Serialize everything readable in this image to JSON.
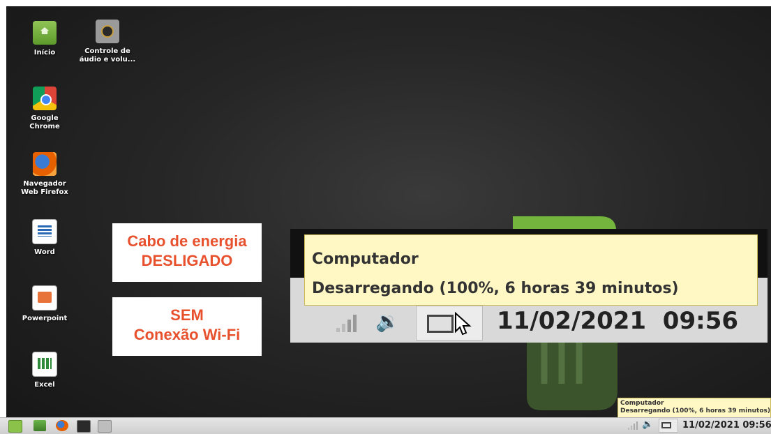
{
  "desktop": {
    "icons": [
      {
        "label_line1": "Início",
        "label_line2": "",
        "icon": "home-folder-icon"
      },
      {
        "label_line1": "Controle de",
        "label_line2": "áudio e volu...",
        "icon": "speaker-icon"
      },
      {
        "label_line1": "Google",
        "label_line2": "Chrome",
        "icon": "chrome-icon"
      },
      {
        "label_line1": "Navegador",
        "label_line2": "Web Firefox",
        "icon": "firefox-icon"
      },
      {
        "label_line1": "Word",
        "label_line2": "",
        "icon": "word-icon"
      },
      {
        "label_line1": "Powerpoint",
        "label_line2": "",
        "icon": "powerpoint-icon"
      },
      {
        "label_line1": "Excel",
        "label_line2": "",
        "icon": "excel-icon"
      }
    ]
  },
  "notes": {
    "power": {
      "line1": "Cabo de energia",
      "line2": "DESLIGADO"
    },
    "wifi": {
      "line1": "SEM",
      "line2": "Conexão Wi-Fi"
    }
  },
  "tooltip": {
    "title": "Computador",
    "status": "Desarregando (100%, 6 horas 39 minutos)"
  },
  "tray": {
    "date": "11/02/2021",
    "time": "09:56"
  },
  "colors": {
    "accent_note": "#e8512e",
    "tooltip_bg": "#fff8c4",
    "mint_green": "#8bc34a"
  }
}
